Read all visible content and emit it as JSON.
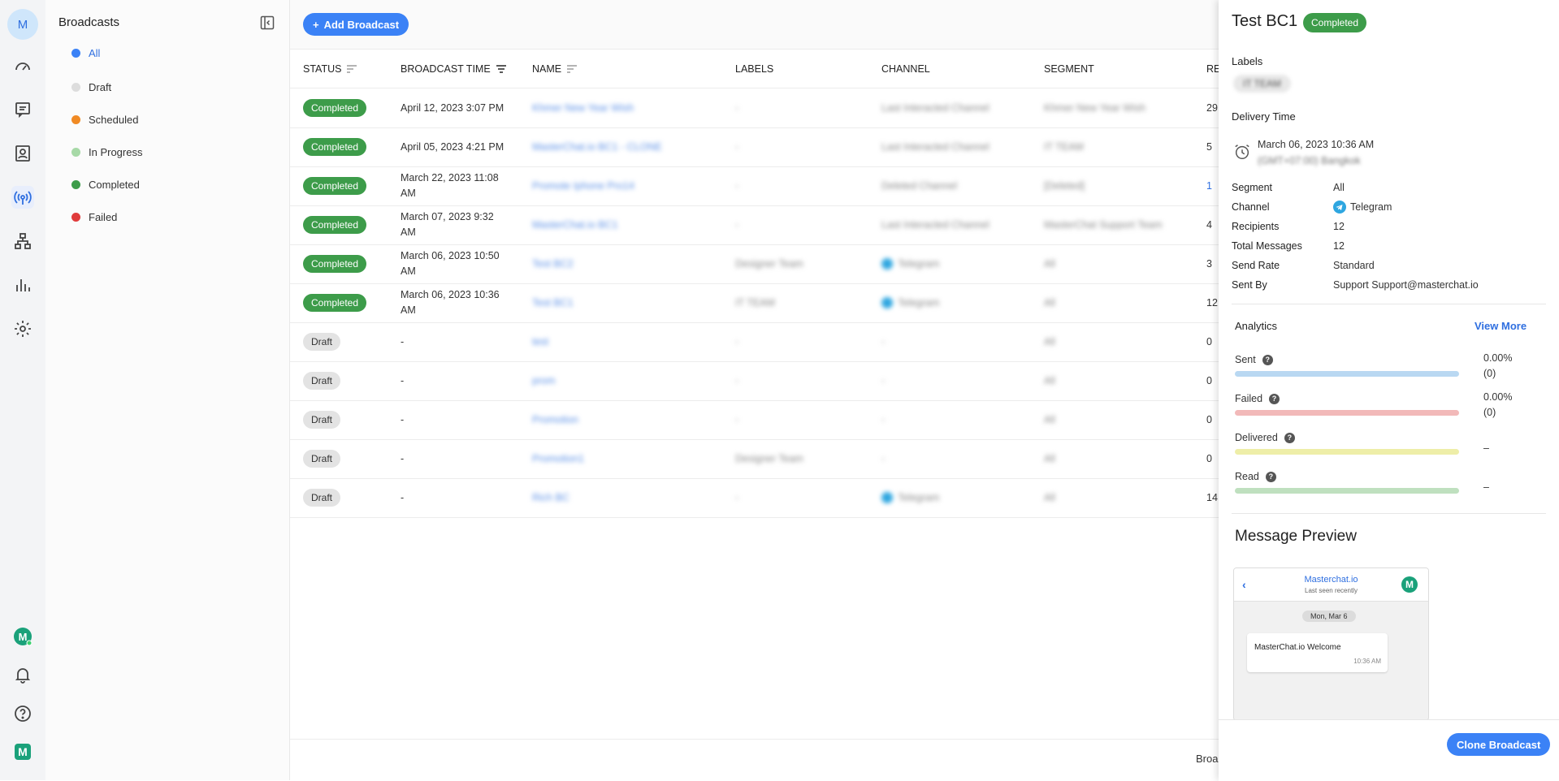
{
  "rail": {
    "avatar": "M"
  },
  "nav": {
    "title": "Broadcasts",
    "items": [
      {
        "label": "All",
        "color": "#3b82f6"
      },
      {
        "label": "Draft",
        "color": "#dddddd"
      },
      {
        "label": "Scheduled",
        "color": "#f08a24"
      },
      {
        "label": "In Progress",
        "color": "#a7d9a7"
      },
      {
        "label": "Completed",
        "color": "#3d9c4a"
      },
      {
        "label": "Failed",
        "color": "#e03b3b"
      }
    ]
  },
  "toolbar": {
    "add_label": "Add Broadcast"
  },
  "table": {
    "headers": [
      "STATUS",
      "BROADCAST TIME",
      "NAME",
      "LABELS",
      "CHANNEL",
      "SEGMENT",
      "RE"
    ],
    "rows": [
      {
        "status": "Completed",
        "time": "April 12, 2023 3:07 PM",
        "name": "Khmer New Year Wish",
        "labels": "-",
        "channel": "Last Interacted Channel",
        "segment": "Khmer New Year Wish",
        "re": "29"
      },
      {
        "status": "Completed",
        "time": "April 05, 2023 4:21 PM",
        "name": "MasterChat.io BC1 - CLONE",
        "labels": "-",
        "channel": "Last Interacted Channel",
        "segment": "IT TEAM",
        "re": "5"
      },
      {
        "status": "Completed",
        "time": "March 22, 2023 11:08 AM",
        "name": "Promote Iphone Pro14",
        "labels": "-",
        "channel": "Deleted Channel",
        "segment": "[Deleted]",
        "re": "1"
      },
      {
        "status": "Completed",
        "time": "March 07, 2023 9:32 AM",
        "name": "MasterChat.io BC1",
        "labels": "-",
        "channel": "Last Interacted Channel",
        "segment": "MasterChat Support Team",
        "re": "4"
      },
      {
        "status": "Completed",
        "time": "March 06, 2023 10:50 AM",
        "name": "Test BC2",
        "labels": "Designer Team",
        "channel": "Telegram",
        "segment": "All",
        "re": "3"
      },
      {
        "status": "Completed",
        "time": "March 06, 2023 10:36 AM",
        "name": "Test BC1",
        "labels": "IT TEAM",
        "channel": "Telegram",
        "segment": "All",
        "re": "12"
      },
      {
        "status": "Draft",
        "time": "-",
        "name": "test",
        "labels": "-",
        "channel": "-",
        "segment": "All",
        "re": "0"
      },
      {
        "status": "Draft",
        "time": "-",
        "name": "prom",
        "labels": "-",
        "channel": "-",
        "segment": "All",
        "re": "0"
      },
      {
        "status": "Draft",
        "time": "-",
        "name": "Promotion",
        "labels": "-",
        "channel": "-",
        "segment": "All",
        "re": "0"
      },
      {
        "status": "Draft",
        "time": "-",
        "name": "Promotion1",
        "labels": "Designer Team",
        "channel": "-",
        "segment": "All",
        "re": "0"
      },
      {
        "status": "Draft",
        "time": "-",
        "name": "Rich BC",
        "labels": "-",
        "channel": "Telegram",
        "segment": "All",
        "re": "14"
      }
    ],
    "footer": "Broa"
  },
  "panel": {
    "title": "Test BC1",
    "status": "Completed",
    "labels_heading": "Labels",
    "label_chip": "IT TEAM",
    "delivery_heading": "Delivery Time",
    "delivery_time": "March 06, 2023 10:36 AM",
    "delivery_tz": "(GMT+07:00) Bangkok",
    "details": [
      {
        "key": "Segment",
        "value": "All"
      },
      {
        "key": "Channel",
        "value": "Telegram"
      },
      {
        "key": "Recipients",
        "value": "12"
      },
      {
        "key": "Total Messages",
        "value": "12"
      },
      {
        "key": "Send Rate",
        "value": "Standard"
      },
      {
        "key": "Sent By",
        "value": "Support Support@masterchat.io"
      }
    ],
    "analytics_title": "Analytics",
    "view_more": "View More",
    "metrics": [
      {
        "label": "Sent",
        "pct": "0.00%",
        "count": "(0)",
        "fraction": 0,
        "color": "#b9d8f2"
      },
      {
        "label": "Failed",
        "pct": "0.00%",
        "count": "(0)",
        "fraction": 0,
        "color": "#f2b9b9"
      },
      {
        "label": "Delivered",
        "pct": "–",
        "count": "",
        "fraction": 0,
        "color": "#eeeea8"
      },
      {
        "label": "Read",
        "pct": "–",
        "count": "",
        "fraction": 0,
        "color": "#bfe0bf"
      }
    ],
    "preview_title": "Message Preview",
    "preview": {
      "name": "Masterchat.io",
      "status": "Last seen recently",
      "date": "Mon, Mar 6",
      "message": "MasterChat.io Welcome",
      "time": "10:36 AM"
    },
    "clone_label": "Clone Broadcast"
  }
}
